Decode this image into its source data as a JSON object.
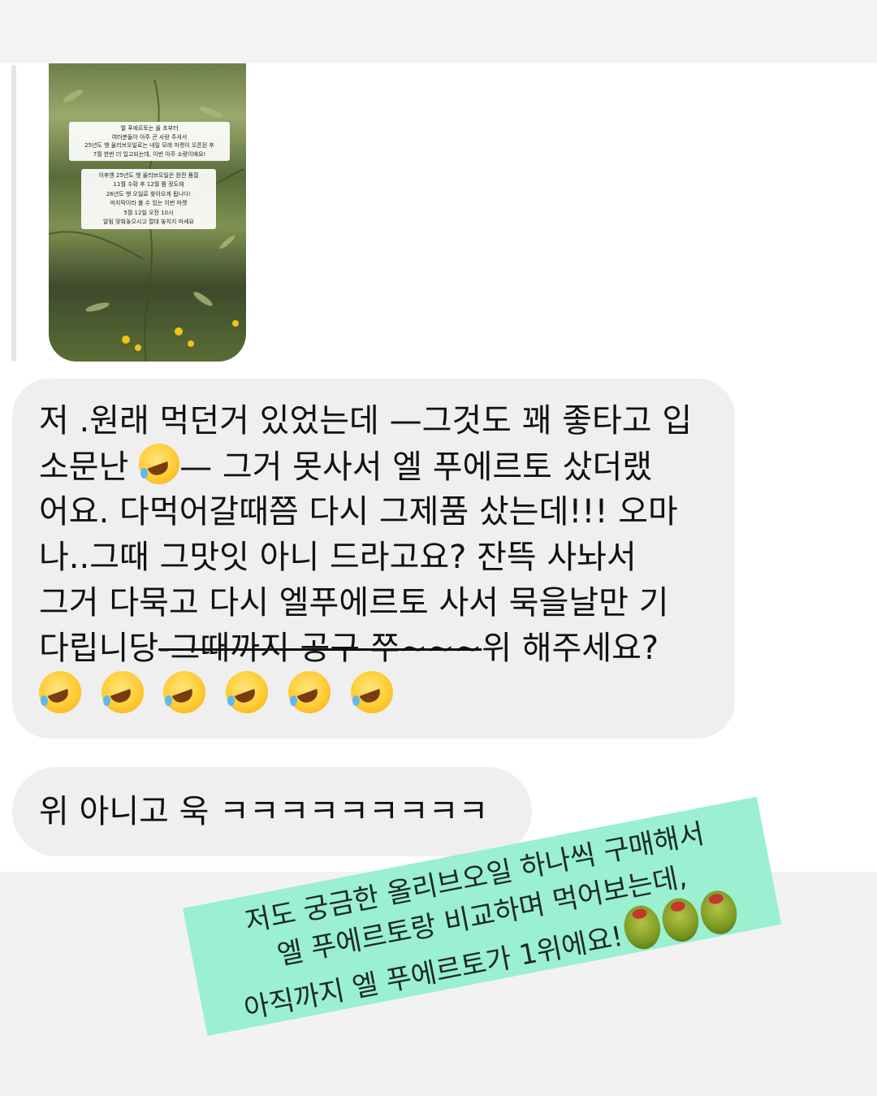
{
  "story": {
    "overlay_lines_1": [
      "엘 푸에르토는 올 초부터",
      "여러분들이 아주 큰 사랑 주셔서",
      "25년도 햇 올리브오일로는 내일 모레 마켓이 오픈된 후",
      "7월 한번 더 입고되는데, 이번 아주 소량이에요!"
    ],
    "overlay_lines_2": [
      "이후엔 25년도 햇 올리브오일은 완전 품절",
      "11월 수확 후 12월 쯤 정도에",
      "26년도 햇 오일로 찾아오게 됩니다!",
      "마지막이라 볼 수 있는 이번 마켓",
      "5월 12일 오전 10시",
      "알림 맞춰놓으시고 절대 놓치지 마세요"
    ]
  },
  "message1": {
    "line1": "저 .원래 먹던거 있었는데 —그것도 꽤 좋타고 입",
    "line2_a": "소문난 ",
    "line2_b": "— 그거  못사서  엘 푸에르토 샀더랬",
    "line3": "어요.  다먹어갈때쯤 다시 그제품 샀는데!!!  오마",
    "line4": "나..그때  그맛잇 아니 드라고요?  잔뜩 사놔서",
    "line5": "그거 다묵고 다시 엘푸에르토 사서 묵을날만 기",
    "line6_a": "다립니당",
    "line6_strike": "-그때까지 공구 쭈~~~",
    "line6_b": "위 해주세요?",
    "emoji_count_label": "rolling-on-floor-laughing x6"
  },
  "message2": {
    "text": "위 아니고 욱 ㅋㅋㅋㅋㅋㅋㅋㅋㅋ"
  },
  "sticker": {
    "line1": "저도 궁금한 올리브오일 하나씩 구매해서",
    "line2": "엘 푸에르토랑 비교하며 먹어보는데,",
    "line3": "아직까지 엘 푸에르토가 1위에요!"
  },
  "colors": {
    "bubble": "#efefef",
    "sticker": "#9af0d0",
    "background": "#ffffff"
  }
}
